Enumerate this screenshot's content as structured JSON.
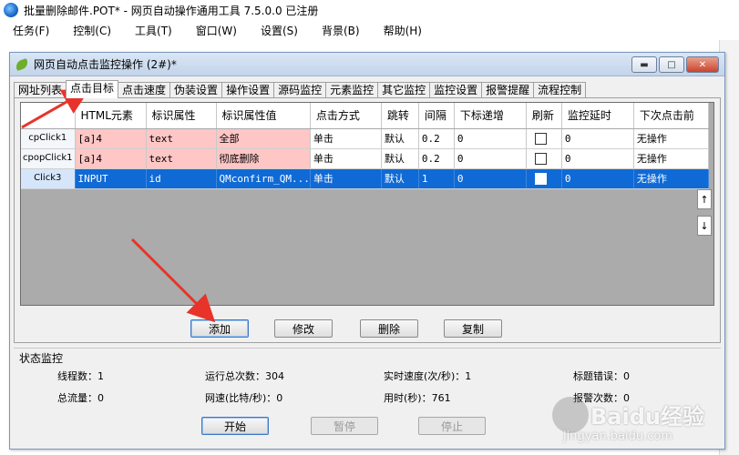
{
  "window": {
    "title": "批量删除邮件.POT* - 网页自动操作通用工具 7.5.0.0  已注册"
  },
  "menu": [
    "任务(F)",
    "控制(C)",
    "工具(T)",
    "窗口(W)",
    "设置(S)",
    "背景(B)",
    "帮助(H)"
  ],
  "inner_window": {
    "title": "网页自动点击监控操作  (2#)*",
    "buttons": {
      "minimize": "▬",
      "maximize": "□",
      "close": "✕"
    }
  },
  "tabs": [
    "网址列表",
    "点击目标",
    "点击速度",
    "伪装设置",
    "操作设置",
    "源码监控",
    "元素监控",
    "其它监控",
    "监控设置",
    "报警提醒",
    "流程控制"
  ],
  "active_tab": "点击目标",
  "table": {
    "columns": [
      "HTML元素",
      "标识属性",
      "标识属性值",
      "点击方式",
      "跳转",
      "间隔",
      "下标递增",
      "刷新",
      "监控延时",
      "下次点击前"
    ],
    "rows": [
      {
        "header": "cpClick1",
        "cells": [
          "[a]4",
          "text",
          "全部",
          "单击",
          "默认",
          "0.2",
          "0",
          "",
          "0",
          "无操作"
        ],
        "selected": false
      },
      {
        "header": "cpopClick1",
        "cells": [
          "[a]4",
          "text",
          "彻底删除",
          "单击",
          "默认",
          "0.2",
          "0",
          "",
          "0",
          "无操作"
        ],
        "selected": false
      },
      {
        "header": "Click3",
        "cells": [
          "INPUT",
          "id",
          "QMconfirm_QM...",
          "单击",
          "默认",
          "1",
          "0",
          "",
          "0",
          "无操作"
        ],
        "selected": true
      }
    ],
    "scroll_up": "↑",
    "scroll_down": "↓"
  },
  "actions": {
    "add": "添加",
    "edit": "修改",
    "delete": "删除",
    "copy": "复制"
  },
  "status": {
    "title": "状态监控",
    "threads_label": "线程数：",
    "threads": "1",
    "total_runs_label": "运行总次数：",
    "total_runs": "304",
    "speed_label": "实时速度(次/秒)：",
    "speed": "1",
    "title_errors_label": "标题错误：",
    "title_errors": "0",
    "traffic_label": "总流量：",
    "traffic": "0",
    "net_speed_label": "网速(比特/秒)：",
    "net_speed": "0",
    "elapsed_label": "用时(秒)：",
    "elapsed": "761",
    "alarms_label": "报警次数：",
    "alarms": "0"
  },
  "controls": {
    "start": "开始",
    "pause": "暂停",
    "stop": "停止"
  },
  "watermark": {
    "brand": "Baidu经验",
    "url": "jingyan.baidu.com"
  },
  "colors": {
    "selection": "#0f6ad6",
    "highlight_pink": "#ffc6c6",
    "arrow_red": "#e8332a"
  }
}
